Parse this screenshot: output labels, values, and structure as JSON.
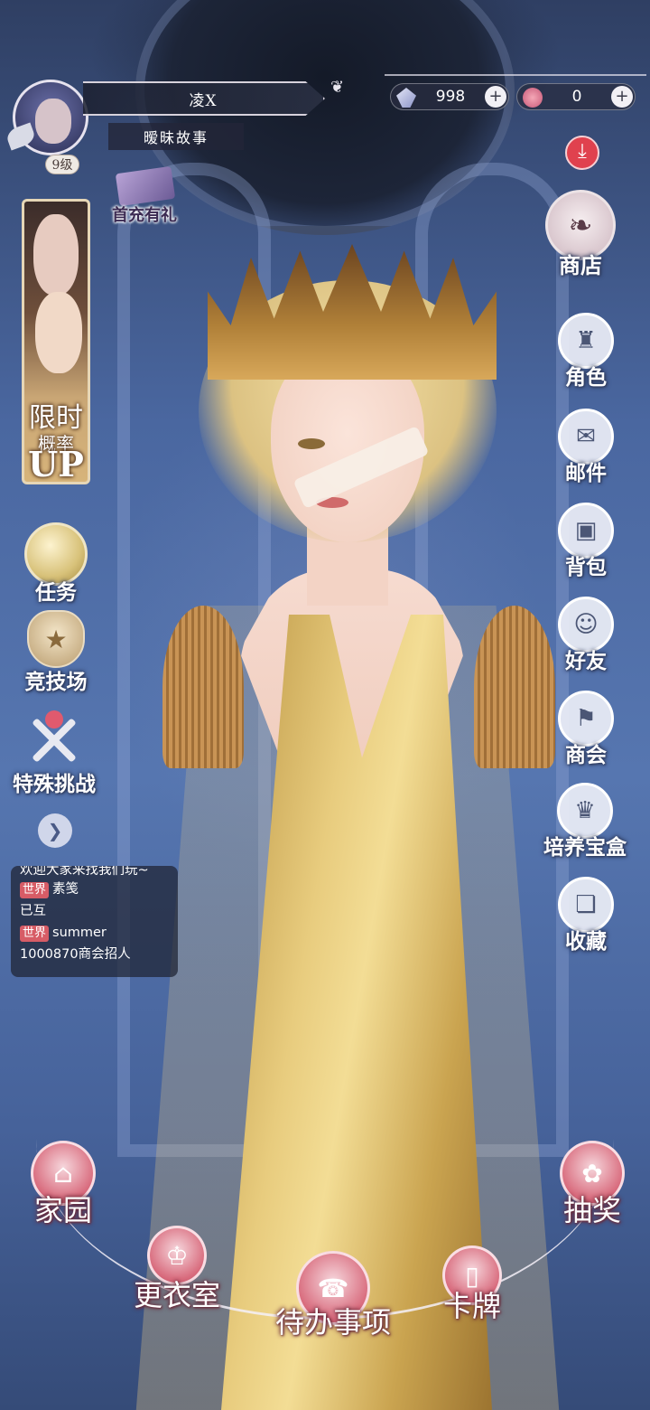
{
  "player": {
    "name": "凌X",
    "title": "暧昧故事",
    "level": "9级"
  },
  "currency": {
    "diamonds": "998",
    "roses": "0"
  },
  "promo": {
    "first_recharge": "首充有礼",
    "banner_line1": "限时",
    "banner_line2": "概率",
    "banner_line3": "UP"
  },
  "left_menu": {
    "task": "任务",
    "arena": "竞技场",
    "challenge": "特殊挑战"
  },
  "chat": {
    "messages": [
      {
        "channel": "",
        "text": "欢迎大家来找我们玩~"
      },
      {
        "channel": "世界",
        "text": "素笺"
      },
      {
        "channel": "",
        "text": "已互"
      },
      {
        "channel": "世界",
        "text": "summer"
      },
      {
        "channel": "",
        "text": "1000870商会招人"
      }
    ]
  },
  "right_menu": {
    "shop": "商店",
    "character": "角色",
    "mail": "邮件",
    "bag": "背包",
    "friends": "好友",
    "guild": "商会",
    "nurture_box": "培养宝盒",
    "collection": "收藏"
  },
  "bottom_nav": {
    "home": "家园",
    "draw": "抽奖",
    "wardrobe": "更衣室",
    "todo": "待办事项",
    "card": "卡牌"
  },
  "icons": {
    "download": "download-icon",
    "plus": "+",
    "chat_toggle": "chevron-icon"
  },
  "colors": {
    "accent_red": "#e0414e",
    "chat_tag": "#d75c66",
    "nav_rose": "#d86a7c"
  }
}
